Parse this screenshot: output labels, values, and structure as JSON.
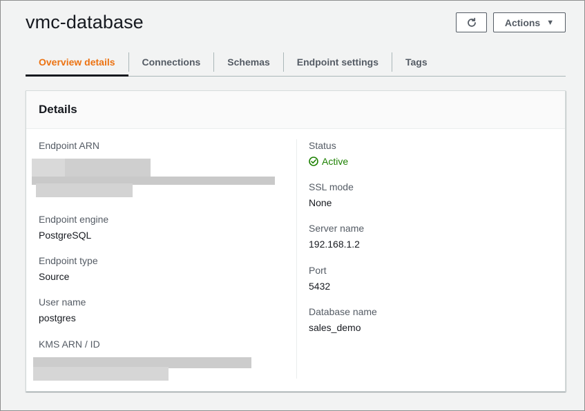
{
  "page": {
    "title": "vmc-database"
  },
  "header": {
    "refresh_icon": "refresh-icon",
    "actions_label": "Actions",
    "actions_caret": "▼"
  },
  "tabs": [
    {
      "label": "Overview details",
      "active": true
    },
    {
      "label": "Connections",
      "active": false
    },
    {
      "label": "Schemas",
      "active": false
    },
    {
      "label": "Endpoint settings",
      "active": false
    },
    {
      "label": "Tags",
      "active": false
    }
  ],
  "details": {
    "title": "Details",
    "left": {
      "endpoint_arn_label": "Endpoint ARN",
      "endpoint_engine_label": "Endpoint engine",
      "endpoint_engine_value": "PostgreSQL",
      "endpoint_type_label": "Endpoint type",
      "endpoint_type_value": "Source",
      "user_name_label": "User name",
      "user_name_value": "postgres",
      "kms_arn_label": "KMS ARN / ID"
    },
    "right": {
      "status_label": "Status",
      "status_value": "Active",
      "ssl_mode_label": "SSL mode",
      "ssl_mode_value": "None",
      "server_name_label": "Server name",
      "server_name_value": "192.168.1.2",
      "port_label": "Port",
      "port_value": "5432",
      "database_name_label": "Database name",
      "database_name_value": "sales_demo"
    }
  },
  "colors": {
    "accent": "#ec7211",
    "status_success": "#1d8102",
    "text_primary": "#16191f",
    "text_secondary": "#545b64"
  }
}
